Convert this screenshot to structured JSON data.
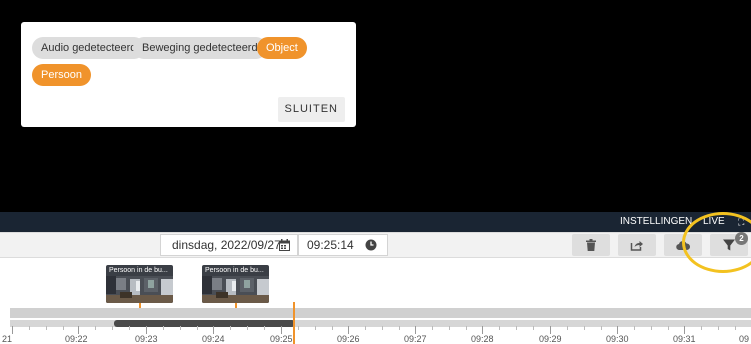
{
  "filter_popup": {
    "chips": [
      {
        "label": "Audio gedetecteerd",
        "active": false
      },
      {
        "label": "Beweging gedetecteerd",
        "active": false
      },
      {
        "label": "Object",
        "active": true
      },
      {
        "label": "Persoon",
        "active": true
      }
    ],
    "close_label": "SLUITEN"
  },
  "live_bar": {
    "settings_label": "INSTELLINGEN",
    "live_label": "LIVE"
  },
  "toolbar": {
    "date": "dinsdag, 2022/09/27",
    "time": "09:25:14",
    "filter_badge": "2",
    "icons": [
      "calendar-icon",
      "clock-icon",
      "trash-icon",
      "share-icon",
      "cloud-icon",
      "filter-icon"
    ]
  },
  "events": [
    {
      "label": "Persoon in de bu..."
    },
    {
      "label": "Persoon in de bu..."
    }
  ],
  "timeline": {
    "labels": [
      "21",
      "09:22",
      "09:23",
      "09:24",
      "09:25",
      "09:26",
      "09:27",
      "09:28",
      "09:29",
      "09:30",
      "09:31",
      "09"
    ]
  },
  "colors": {
    "accent": "#f0932b",
    "highlight_ring": "#f3c220",
    "live_bar": "#1a2533",
    "video_bg": "#000000"
  }
}
